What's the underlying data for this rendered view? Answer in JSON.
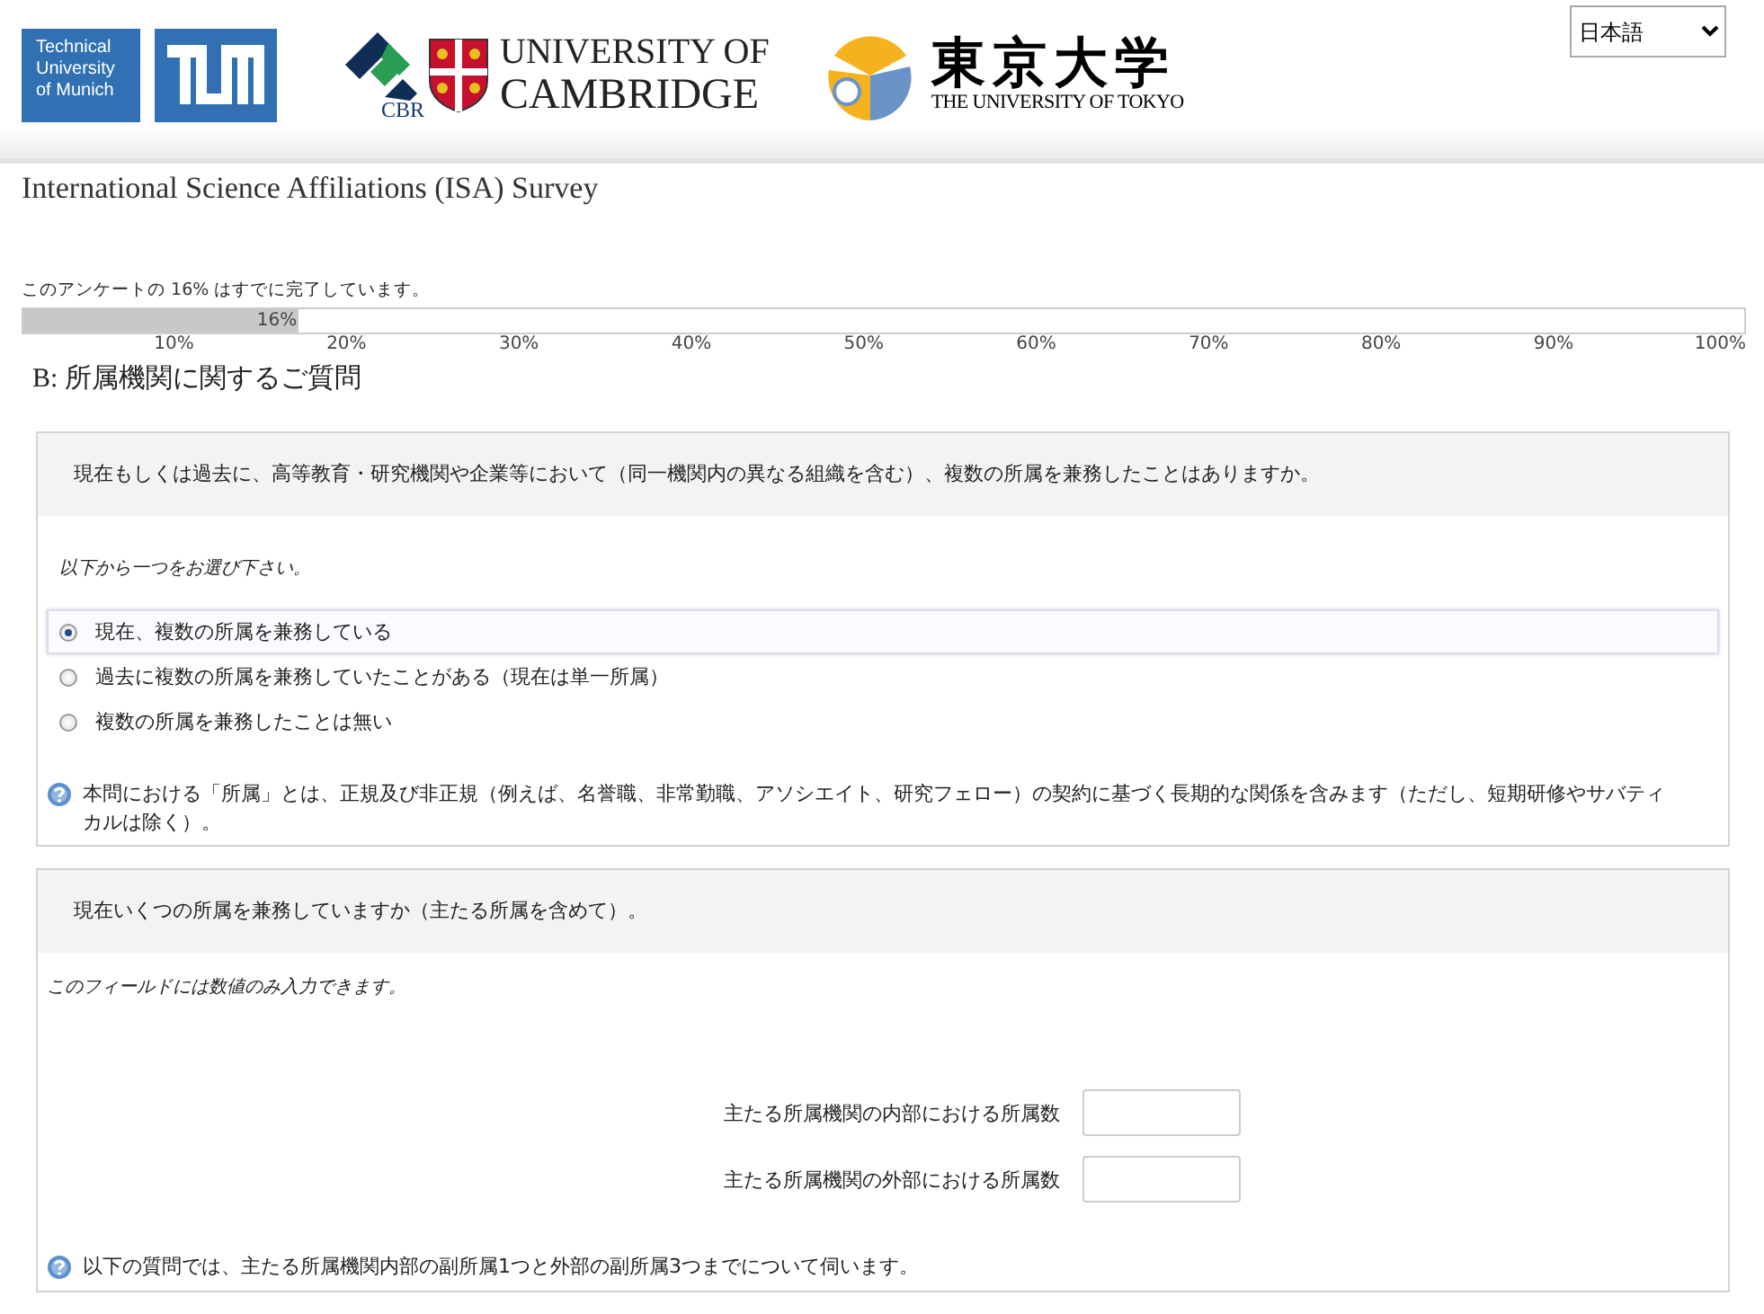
{
  "header": {
    "tum": {
      "lines": [
        "Technical",
        "University",
        "of Munich"
      ]
    },
    "cambridge": {
      "cbr": "CBR",
      "line1": "UNIVERSITY OF",
      "line2": "CAMBRIDGE"
    },
    "tokyo": {
      "name": "東京大学",
      "subtitle": "THE UNIVERSITY OF TOKYO"
    },
    "language": {
      "value": "日本語"
    }
  },
  "title": "International Science Affiliations (ISA) Survey",
  "progress": {
    "before": "このアンケートの",
    "percent": "16%",
    "after": "はすでに完了しています。",
    "level": 0.16,
    "bar_label": "16%",
    "ticks": [
      "10%",
      "20%",
      "30%",
      "40%",
      "50%",
      "60%",
      "70%",
      "80%",
      "90%",
      "100%"
    ]
  },
  "section": "B: 所属機関に関するご質問",
  "questions": [
    {
      "kind": "radio",
      "text": "現在もしくは過去に、高等教育・研究機関や企業等において（同一機関内の異なる組織を含む）、複数の所属を兼務したことはありますか。",
      "hint": "以下から一つをお選び下さい。",
      "options": [
        {
          "label": "現在、複数の所属を兼務している",
          "selected": true
        },
        {
          "label": "過去に複数の所属を兼務していたことがある（現在は単一所属）",
          "selected": false
        },
        {
          "label": "複数の所属を兼務したことは無い",
          "selected": false
        }
      ],
      "help": "本問における「所属」とは、正規及び非正規（例えば、名誉職、非常勤職、アソシエイト、研究フェロー）の契約に基づく長期的な関係を含みます（ただし、短期研修やサバティカルは除く）。"
    },
    {
      "kind": "numeric",
      "text": "現在いくつの所属を兼務していますか（主たる所属を含めて）。",
      "hint": "このフィールドには数値のみ入力できます。",
      "fields": [
        {
          "label": "主たる所属機関の内部における所属数"
        },
        {
          "label": "主たる所属機関の外部における所属数"
        }
      ],
      "help": "以下の質問では、主たる所属機関内部の副所属1つと外部の副所属3つまでについて伺います。"
    }
  ]
}
